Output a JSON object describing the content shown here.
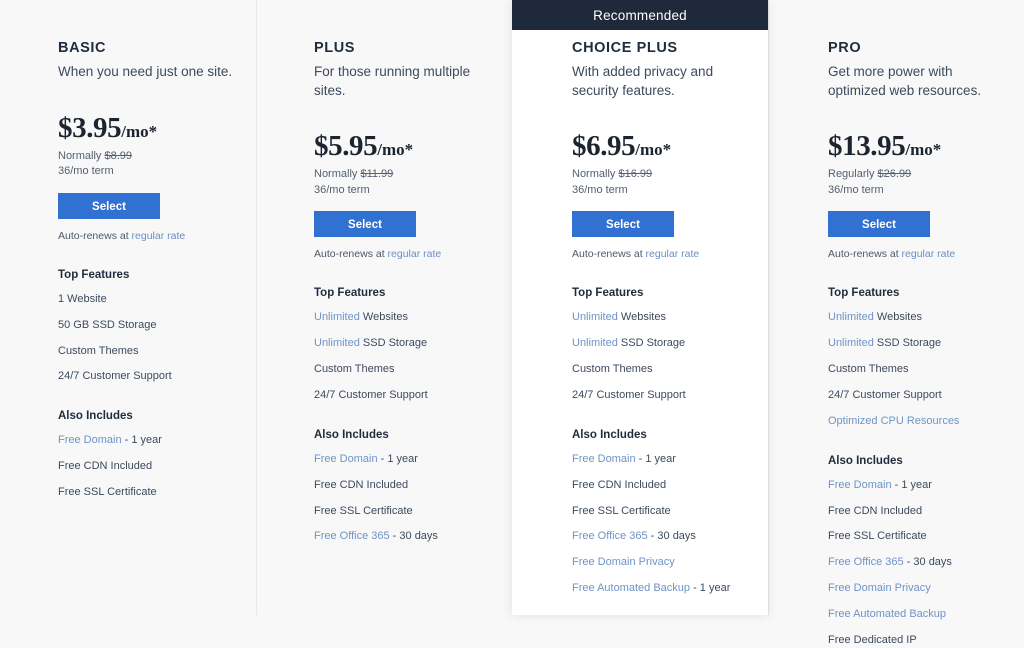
{
  "ribbon": {
    "label": "Recommended"
  },
  "colors": {
    "page_background": "#f8f8f9",
    "ribbon_background": "#1e293b",
    "button_background": "#3071d1",
    "link_blue": "#6f93c6",
    "text_primary": "#1e2c3c",
    "divider": "#e6e7ea"
  },
  "common": {
    "top_features_label": "Top Features",
    "also_includes_label": "Also Includes",
    "select_label": "Select",
    "autorenew_prefix": "Auto-renews at ",
    "autorenew_link": "regular rate",
    "term": "36/mo term",
    "price_suffix": "/mo*"
  },
  "plans": [
    {
      "name": "BASIC",
      "tagline": "When you need just one site.",
      "price": "$3.95",
      "price_suffix": "/mo*",
      "normally_prefix": "Normally ",
      "normally_price": "$8.99",
      "term": "36/mo term",
      "select_label": "Select",
      "autorenew_prefix": "Auto-renews at ",
      "autorenew_link": "regular rate",
      "top_features_label": "Top Features",
      "top_features": [
        {
          "link": "",
          "text": "1 Website"
        },
        {
          "link": "",
          "text": "50 GB SSD Storage"
        },
        {
          "link": "",
          "text": "Custom Themes"
        },
        {
          "link": "",
          "text": "24/7 Customer Support"
        }
      ],
      "also_includes_label": "Also Includes",
      "also_includes": [
        {
          "link": "Free Domain",
          "text": " - 1 year"
        },
        {
          "link": "",
          "text": "Free CDN Included"
        },
        {
          "link": "",
          "text": "Free SSL Certificate"
        }
      ],
      "recommended": false
    },
    {
      "name": "PLUS",
      "tagline": "For those running multiple sites.",
      "price": "$5.95",
      "price_suffix": "/mo*",
      "normally_prefix": "Normally ",
      "normally_price": "$11.99",
      "term": "36/mo term",
      "select_label": "Select",
      "autorenew_prefix": "Auto-renews at ",
      "autorenew_link": "regular rate",
      "top_features_label": "Top Features",
      "top_features": [
        {
          "link": "Unlimited",
          "text": " Websites"
        },
        {
          "link": "Unlimited",
          "text": " SSD Storage"
        },
        {
          "link": "",
          "text": "Custom Themes"
        },
        {
          "link": "",
          "text": "24/7 Customer Support"
        }
      ],
      "also_includes_label": "Also Includes",
      "also_includes": [
        {
          "link": "Free Domain",
          "text": " - 1 year"
        },
        {
          "link": "",
          "text": "Free CDN Included"
        },
        {
          "link": "",
          "text": "Free SSL Certificate"
        },
        {
          "link": "Free Office 365",
          "text": " - 30 days"
        }
      ],
      "recommended": false
    },
    {
      "name": "CHOICE PLUS",
      "tagline": "With added privacy and security features.",
      "price": "$6.95",
      "price_suffix": "/mo*",
      "normally_prefix": "Normally ",
      "normally_price": "$16.99",
      "term": "36/mo term",
      "select_label": "Select",
      "autorenew_prefix": "Auto-renews at ",
      "autorenew_link": "regular rate",
      "top_features_label": "Top Features",
      "top_features": [
        {
          "link": "Unlimited",
          "text": " Websites"
        },
        {
          "link": "Unlimited",
          "text": " SSD Storage"
        },
        {
          "link": "",
          "text": "Custom Themes"
        },
        {
          "link": "",
          "text": "24/7 Customer Support"
        }
      ],
      "also_includes_label": "Also Includes",
      "also_includes": [
        {
          "link": "Free Domain",
          "text": " - 1 year"
        },
        {
          "link": "",
          "text": "Free CDN Included"
        },
        {
          "link": "",
          "text": "Free SSL Certificate"
        },
        {
          "link": "Free Office 365",
          "text": " - 30 days"
        },
        {
          "link": "Free Domain Privacy",
          "text": ""
        },
        {
          "link": "Free Automated Backup",
          "text": " - 1 year"
        }
      ],
      "recommended": true
    },
    {
      "name": "PRO",
      "tagline": "Get more power with optimized web resources.",
      "price": "$13.95",
      "price_suffix": "/mo*",
      "normally_prefix": "Regularly ",
      "normally_price": "$26.99",
      "term": "36/mo term",
      "select_label": "Select",
      "autorenew_prefix": "Auto-renews at ",
      "autorenew_link": "regular rate",
      "top_features_label": "Top Features",
      "top_features": [
        {
          "link": "Unlimited",
          "text": " Websites"
        },
        {
          "link": "Unlimited",
          "text": " SSD Storage"
        },
        {
          "link": "",
          "text": "Custom Themes"
        },
        {
          "link": "",
          "text": "24/7 Customer Support"
        },
        {
          "link": "Optimized CPU Resources",
          "text": ""
        }
      ],
      "also_includes_label": "Also Includes",
      "also_includes": [
        {
          "link": "Free Domain",
          "text": " - 1 year"
        },
        {
          "link": "",
          "text": "Free CDN Included"
        },
        {
          "link": "",
          "text": "Free SSL Certificate"
        },
        {
          "link": "Free Office 365",
          "text": " - 30 days"
        },
        {
          "link": "Free Domain Privacy",
          "text": ""
        },
        {
          "link": "Free Automated Backup",
          "text": ""
        },
        {
          "link": "",
          "text": "Free Dedicated IP"
        }
      ],
      "recommended": false
    }
  ]
}
